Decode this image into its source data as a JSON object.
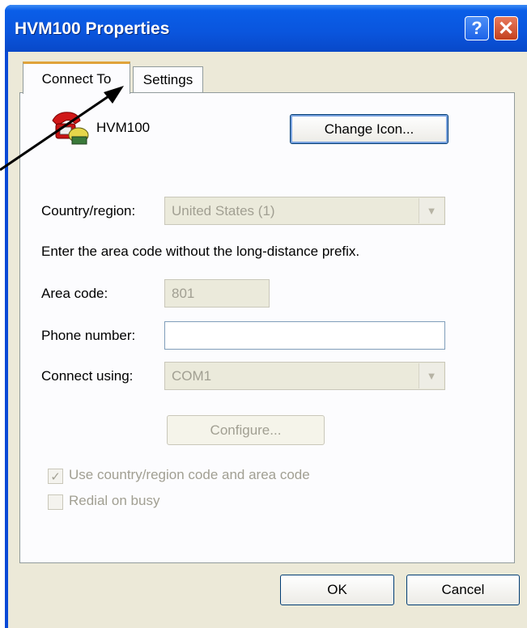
{
  "window": {
    "title": "HVM100 Properties"
  },
  "tabs": [
    {
      "label": "Connect To"
    },
    {
      "label": "Settings"
    }
  ],
  "connection": {
    "name": "HVM100",
    "change_icon_label": "Change Icon..."
  },
  "country": {
    "label": "Country/region:",
    "value": "United States (1)"
  },
  "instructions": "Enter the area code without the long-distance prefix.",
  "area_code": {
    "label": "Area code:",
    "value": "801"
  },
  "phone": {
    "label": "Phone number:",
    "value": ""
  },
  "connect_using": {
    "label": "Connect using:",
    "value": "COM1"
  },
  "configure_label": "Configure...",
  "checkboxes": [
    {
      "label": "Use country/region code and area code",
      "checked": true
    },
    {
      "label": "Redial on busy",
      "checked": false
    }
  ],
  "footer": {
    "ok_label": "OK",
    "cancel_label": "Cancel"
  }
}
